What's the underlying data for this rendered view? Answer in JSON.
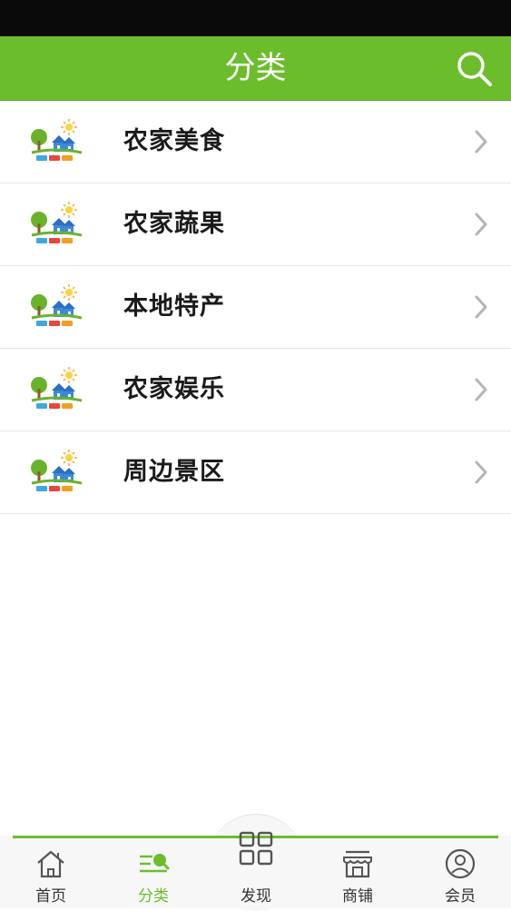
{
  "header": {
    "title": "分类",
    "search_icon": "search-icon",
    "bg_color": "#6cbd2c"
  },
  "categories": [
    {
      "label": "农家美食",
      "icon": "farm-logo-icon"
    },
    {
      "label": "农家蔬果",
      "icon": "farm-logo-icon"
    },
    {
      "label": "本地特产",
      "icon": "farm-logo-icon"
    },
    {
      "label": "农家娱乐",
      "icon": "farm-logo-icon"
    },
    {
      "label": "周边景区",
      "icon": "farm-logo-icon"
    }
  ],
  "tabbar": {
    "active": "分类",
    "items": [
      {
        "label": "首页",
        "icon": "home-icon"
      },
      {
        "label": "分类",
        "icon": "category-icon"
      },
      {
        "label": "发现",
        "icon": "grid-icon"
      },
      {
        "label": "商铺",
        "icon": "shop-icon"
      },
      {
        "label": "会员",
        "icon": "user-icon"
      }
    ]
  },
  "colors": {
    "accent": "#6cbd2c",
    "text": "#1a1a1a",
    "chevron": "#b5b5b5"
  }
}
